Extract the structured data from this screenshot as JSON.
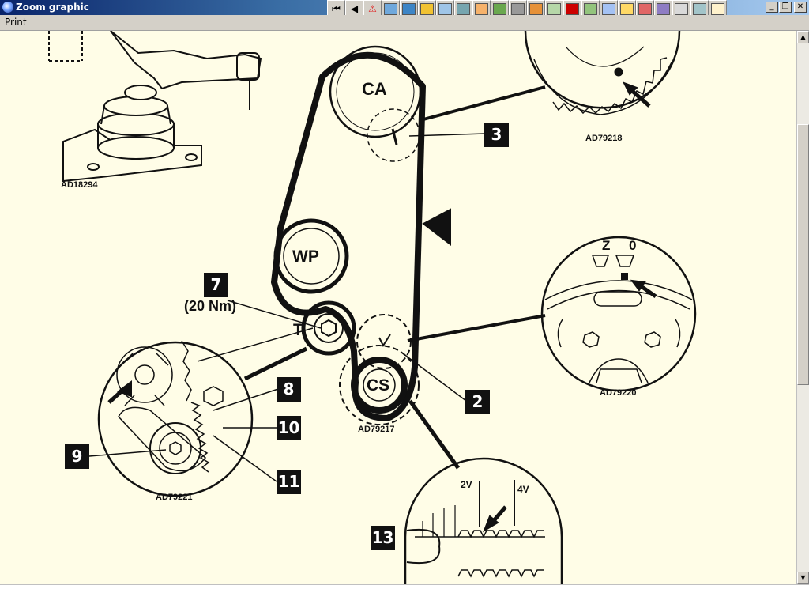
{
  "window": {
    "title": "Zoom graphic",
    "controls": [
      "_",
      "❐",
      "✕"
    ]
  },
  "toolbar": {
    "buttons": [
      {
        "name": "first-page",
        "glyph": "⏮"
      },
      {
        "name": "previous",
        "glyph": "◀"
      },
      {
        "name": "warning",
        "glyph": "⚠",
        "color": "#e02020"
      },
      {
        "name": "tool-1",
        "color": "#6fa8dc"
      },
      {
        "name": "tool-2",
        "color": "#3d85c6"
      },
      {
        "name": "tool-3",
        "color": "#f1c232"
      },
      {
        "name": "tool-4",
        "color": "#9fc5e8"
      },
      {
        "name": "tool-5",
        "color": "#76a5af"
      },
      {
        "name": "tool-6",
        "color": "#f6b26b"
      },
      {
        "name": "tool-7",
        "color": "#6aa84f"
      },
      {
        "name": "tool-8",
        "color": "#999999"
      },
      {
        "name": "tool-9",
        "color": "#e69138"
      },
      {
        "name": "tool-10",
        "color": "#b6d7a8"
      },
      {
        "name": "tool-11",
        "color": "#cc0000"
      },
      {
        "name": "tool-12",
        "color": "#93c47d"
      },
      {
        "name": "tool-13",
        "color": "#a4c2f4"
      },
      {
        "name": "tool-14",
        "color": "#ffd966"
      },
      {
        "name": "tool-15",
        "color": "#e06666"
      },
      {
        "name": "tool-16",
        "color": "#8e7cc3"
      },
      {
        "name": "tool-17",
        "color": "#d9d9d9"
      },
      {
        "name": "tool-18",
        "color": "#a2c4c9"
      },
      {
        "name": "tool-19",
        "color": "#fff2cc"
      }
    ]
  },
  "menu": {
    "items": [
      "Print"
    ]
  },
  "diagram": {
    "pulley_labels": {
      "camshaft": "CA",
      "water_pump": "WP",
      "tensioner": "T",
      "crankshaft": "CS"
    },
    "torque": "(20 Nm)",
    "callouts": {
      "c2": "2",
      "c3": "3",
      "c7": "7",
      "c8": "8",
      "c9": "9",
      "c10": "10",
      "c11": "11",
      "c13": "13"
    },
    "refs": {
      "engine_mount": "AD18294",
      "cam_detail": "AD79218",
      "flywheel_detail": "AD79220",
      "crank_ref": "AD79217",
      "tensioner_detail": "AD79221"
    },
    "marks": {
      "z": "Z",
      "zero": "0",
      "two_v": "2V",
      "four_v": "4V"
    }
  },
  "colors": {
    "canvas_bg": "#fffde7",
    "line": "#111111",
    "title_bar": "#0a246a"
  }
}
